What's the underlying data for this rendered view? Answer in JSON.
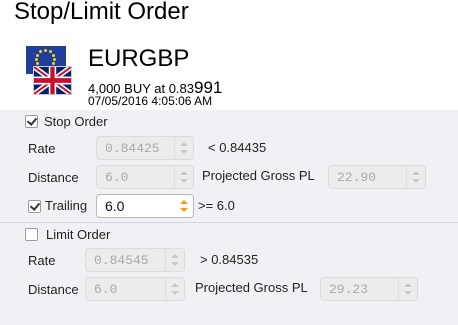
{
  "title": "Stop/Limit Order",
  "instrument": {
    "symbol": "EURGBP",
    "order_prefix": "4,000 BUY at 0.83",
    "order_price_big": "991",
    "timestamp": "07/05/2016 4:05:06 AM"
  },
  "stop_order": {
    "label": "Stop Order",
    "checked": true,
    "rate_label": "Rate",
    "rate_value": "0.84425",
    "rate_hint": "< 0.84435",
    "distance_label": "Distance",
    "distance_value": "6.0",
    "projected_label": "Projected Gross PL",
    "projected_value": "22.90",
    "trailing_label": "Trailing",
    "trailing_checked": true,
    "trailing_value": "6.0",
    "trailing_hint": ">= 6.0"
  },
  "limit_order": {
    "label": "Limit Order",
    "checked": false,
    "rate_label": "Rate",
    "rate_value": "0.84545",
    "rate_hint": "> 0.84535",
    "distance_label": "Distance",
    "distance_value": "6.0",
    "projected_label": "Projected Gross PL",
    "projected_value": "29.23"
  },
  "colors": {
    "panel_bg": "#f1f1f5",
    "spinner_active": "#f29a1b",
    "eu_blue": "#1f3f9a"
  }
}
